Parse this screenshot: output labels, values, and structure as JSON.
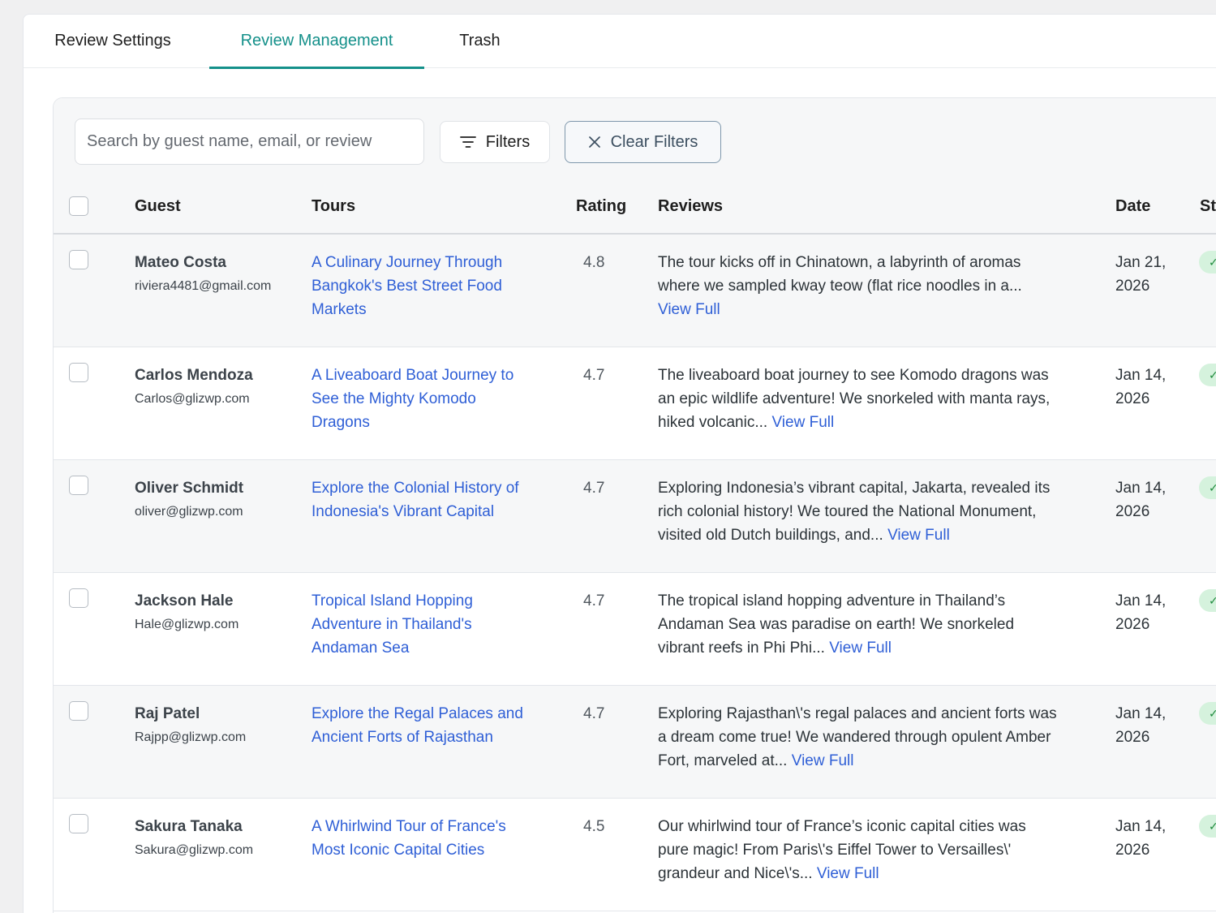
{
  "tabs": [
    {
      "label": "Review Settings",
      "active": false
    },
    {
      "label": "Review Management",
      "active": true
    },
    {
      "label": "Trash",
      "active": false
    }
  ],
  "toolbar": {
    "search_placeholder": "Search by guest name, email, or review",
    "filters_label": "Filters",
    "clear_filters_label": "Clear Filters"
  },
  "columns": {
    "guest": "Guest",
    "tours": "Tours",
    "rating": "Rating",
    "reviews": "Reviews",
    "date": "Date",
    "status": "St"
  },
  "rows": [
    {
      "name": "Mateo Costa",
      "email": "riviera4481@gmail.com",
      "tour": [
        "A Culinary Journey Through",
        "Bangkok's Best Street Food",
        "Markets"
      ],
      "rating": "4.8",
      "review": [
        "The tour kicks off in Chinatown, a labyrinth of aromas",
        "where we sampled kway teow (flat rice noodles in a...",
        ""
      ],
      "view_full": "View Full",
      "date": [
        "Jan 21,",
        "2026"
      ]
    },
    {
      "name": "Carlos Mendoza",
      "email": "Carlos@glizwp.com",
      "tour": [
        "A Liveaboard Boat Journey to",
        "See the Mighty Komodo",
        "Dragons"
      ],
      "rating": "4.7",
      "review": [
        "The liveaboard boat journey to see Komodo dragons was",
        "an epic wildlife adventure! We snorkeled with manta rays,",
        "hiked volcanic... "
      ],
      "view_full": "View Full",
      "date": [
        "Jan 14,",
        "2026"
      ]
    },
    {
      "name": "Oliver Schmidt",
      "email": "oliver@glizwp.com",
      "tour": [
        "Explore the Colonial History of",
        "Indonesia's Vibrant Capital",
        ""
      ],
      "rating": "4.7",
      "review": [
        "Exploring Indonesia’s vibrant capital, Jakarta, revealed its",
        "rich colonial history! We toured the National Monument,",
        "visited old Dutch buildings, and... "
      ],
      "view_full": "View Full",
      "date": [
        "Jan 14,",
        "2026"
      ]
    },
    {
      "name": "Jackson Hale",
      "email": "Hale@glizwp.com",
      "tour": [
        "Tropical Island Hopping",
        "Adventure in Thailand's",
        "Andaman Sea"
      ],
      "rating": "4.7",
      "review": [
        "The tropical island hopping adventure in Thailand’s",
        "Andaman Sea was paradise on earth! We snorkeled",
        "vibrant reefs in Phi Phi... "
      ],
      "view_full": "View Full",
      "date": [
        "Jan 14,",
        "2026"
      ]
    },
    {
      "name": "Raj Patel",
      "email": "Rajpp@glizwp.com",
      "tour": [
        "Explore the Regal Palaces and",
        "Ancient Forts of Rajasthan",
        ""
      ],
      "rating": "4.7",
      "review": [
        "Exploring Rajasthan\\'s regal palaces and ancient forts was",
        "a dream come true! We wandered through opulent Amber",
        "Fort, marveled at... "
      ],
      "view_full": "View Full",
      "date": [
        "Jan 14,",
        "2026"
      ]
    },
    {
      "name": "Sakura Tanaka",
      "email": "Sakura@glizwp.com",
      "tour": [
        "A Whirlwind Tour of France's",
        "Most Iconic Capital Cities",
        ""
      ],
      "rating": "4.5",
      "review": [
        "Our whirlwind tour of France’s iconic capital cities was",
        "pure magic! From Paris\\'s Eiffel Tower to Versailles\\'",
        "grandeur and Nice\\'s... "
      ],
      "view_full": "View Full",
      "date": [
        "Jan 14,",
        "2026"
      ]
    }
  ],
  "colors": {
    "accent": "#14908a",
    "link": "#2f5fd6",
    "status_bg": "#d5f2dd"
  },
  "icons": {
    "filters": "filter-lines-icon",
    "clear": "close-icon",
    "status": "check-icon"
  }
}
